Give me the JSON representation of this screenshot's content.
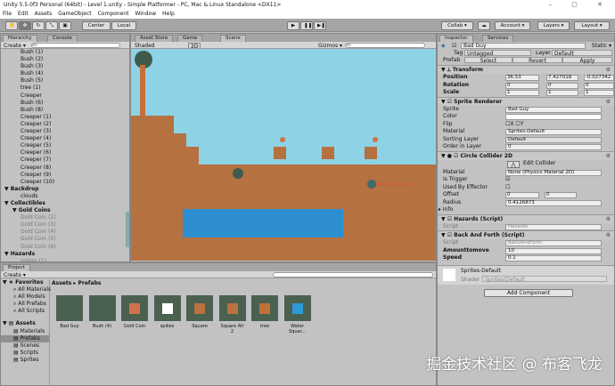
{
  "window": {
    "title": "Unity 5.5.0f3 Personal (64bit) - Level 1.unity - Simple Platformer - PC, Mac & Linux Standalone <DX11>",
    "controls": "– ▢ ✕"
  },
  "menu": [
    "File",
    "Edit",
    "Assets",
    "GameObject",
    "Component",
    "Window",
    "Help"
  ],
  "toolbar": {
    "center": "Center",
    "local": "Local",
    "collab": "Collab ▾",
    "account": "Account ▾",
    "layers": "Layers ▾",
    "layout": "Layout ▾",
    "play": "▶",
    "pause": "❚❚",
    "step": "▶❚"
  },
  "hierarchy": {
    "tab": "Hierarchy",
    "console_tab": "Console",
    "create": "Create ▾",
    "search_placeholder": "All",
    "items": [
      {
        "label": "Bush (1)",
        "indent": 2
      },
      {
        "label": "Bush (2)",
        "indent": 2
      },
      {
        "label": "Bush (3)",
        "indent": 2
      },
      {
        "label": "Bush (4)",
        "indent": 2
      },
      {
        "label": "Bush (5)",
        "indent": 2
      },
      {
        "label": "tree (1)",
        "indent": 2
      },
      {
        "label": "Creeper",
        "indent": 2
      },
      {
        "label": "Bush (6)",
        "indent": 2
      },
      {
        "label": "Bush (8)",
        "indent": 2
      },
      {
        "label": "Creeper (1)",
        "indent": 2
      },
      {
        "label": "Creeper (2)",
        "indent": 2
      },
      {
        "label": "Creeper (3)",
        "indent": 2
      },
      {
        "label": "Creeper (4)",
        "indent": 2
      },
      {
        "label": "Creeper (5)",
        "indent": 2
      },
      {
        "label": "Creeper (6)",
        "indent": 2
      },
      {
        "label": "Creeper (7)",
        "indent": 2
      },
      {
        "label": "Creeper (8)",
        "indent": 2
      },
      {
        "label": "Creeper (9)",
        "indent": 2
      },
      {
        "label": "Creeper (10)",
        "indent": 2
      },
      {
        "label": "▼ Backdrop",
        "indent": 0
      },
      {
        "label": "clouds",
        "indent": 2
      },
      {
        "label": "▼ Collectibles",
        "indent": 0
      },
      {
        "label": "▼ Gold Coins",
        "indent": 1
      },
      {
        "label": "Gold Coin (2)",
        "indent": 2,
        "dim": true
      },
      {
        "label": "Gold Coin (3)",
        "indent": 2,
        "dim": true
      },
      {
        "label": "Gold Coin (4)",
        "indent": 2,
        "dim": true
      },
      {
        "label": "Gold Coin (5)",
        "indent": 2,
        "dim": true
      },
      {
        "label": "Gold Coin (6)",
        "indent": 2,
        "dim": true
      },
      {
        "label": "▼ Hazards",
        "indent": 0
      },
      {
        "label": "spikes (1)",
        "indent": 2,
        "dim": true
      }
    ]
  },
  "scene": {
    "tabs": [
      "Asset Store",
      "Game",
      "Scene"
    ],
    "shading": "Shaded",
    "mode_2d": "2D",
    "gizmos": "Gizmos ▾",
    "search_placeholder": "All"
  },
  "inspector": {
    "tab": "Inspector",
    "services_tab": "Services",
    "object_name": "Bad Guy",
    "static": "Static ▾",
    "tag_label": "Tag",
    "tag": "Untagged",
    "layer_label": "Layer",
    "layer": "Default",
    "prefab_label": "Prefab",
    "select": "Select",
    "revert": "Revert",
    "apply": "Apply",
    "transform": {
      "title": "Transform",
      "position_label": "Position",
      "position": [
        "36.53",
        "7.427018",
        "-0.027342"
      ],
      "rotation_label": "Rotation",
      "rotation": [
        "0",
        "0",
        "0"
      ],
      "scale_label": "Scale",
      "scale": [
        "1",
        "1",
        "1"
      ]
    },
    "sprite_renderer": {
      "title": "Sprite Renderer",
      "sprite_label": "Sprite",
      "sprite": "Bad Guy",
      "color_label": "Color",
      "flip_label": "Flip",
      "flip_x": "X",
      "flip_y": "Y",
      "material_label": "Material",
      "material": "Sprites-Default",
      "sorting_label": "Sorting Layer",
      "sorting": "Default",
      "order_label": "Order in Layer",
      "order": "0"
    },
    "collider": {
      "title": "Circle Collider 2D",
      "edit": "Edit Collider",
      "material_label": "Material",
      "material": "None (Physics Material 2D)",
      "trigger_label": "Is Trigger",
      "effector_label": "Used By Effector",
      "offset_label": "Offset",
      "offset": [
        "0",
        "0"
      ],
      "radius_label": "Radius",
      "radius": "0.4126873",
      "info": "Info"
    },
    "hazards": {
      "title": "Hazards (Script)",
      "script_label": "Script",
      "script": "Hazards"
    },
    "back_forth": {
      "title": "Back And Forth (Script)",
      "script_label": "Script",
      "script": "BackAndForth",
      "amount_label": "Amounttomove",
      "amount": "10",
      "speed_label": "Speed",
      "speed": "0.1"
    },
    "material_preview": {
      "name": "Sprites-Default",
      "shader_label": "Shader",
      "shader": "Sprites/Default"
    },
    "add_component": "Add Component"
  },
  "project": {
    "tab": "Project",
    "create": "Create ▾",
    "breadcrumb": [
      "Assets",
      "Prefabs"
    ],
    "favorites": {
      "label": "Favorites",
      "items": [
        "All Materials",
        "All Models",
        "All Prefabs",
        "All Scripts"
      ]
    },
    "assets": {
      "label": "Assets",
      "items": [
        "Materials",
        "Prefabs",
        "Scenes",
        "Scripts",
        "Sprites"
      ],
      "selected": "Prefabs"
    },
    "files": [
      {
        "name": "Bad Guy",
        "color": "#4b6150"
      },
      {
        "name": "Bush (4)",
        "color": "#4b6150"
      },
      {
        "name": "Gold Coin",
        "color": "#d0734a"
      },
      {
        "name": "spikes",
        "color": "#ffffff"
      },
      {
        "name": "Square",
        "color": "#b8733f"
      },
      {
        "name": "Square Alt 2",
        "color": "#b8733f"
      },
      {
        "name": "tree",
        "color": "#c0703a"
      },
      {
        "name": "Water Squar...",
        "color": "#2e9ad8"
      }
    ]
  },
  "watermark": "掘金技术社区 @ 布客飞龙"
}
